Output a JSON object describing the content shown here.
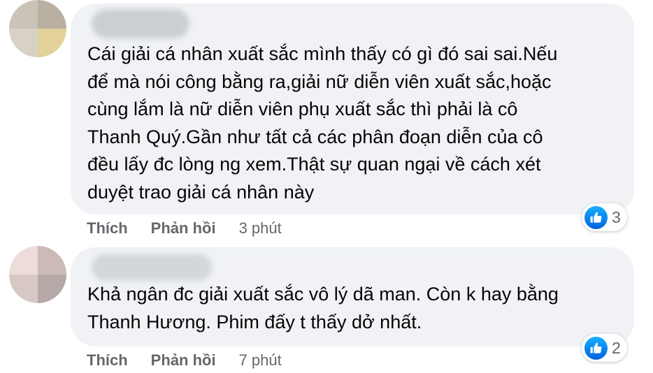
{
  "comments": [
    {
      "text": "Cái giải cá nhân xuất sắc mình thấy có gì đó sai sai.Nếu\nđể mà nói công bằng ra,giải nữ diễn viên xuất sắc,hoặc\ncùng lắm là nữ diễn viên phụ xuất sắc thì phải là cô\nThanh Quý.Gần như tất cả các phân đoạn diễn của cô\nđều lấy đc lòng ng xem.Thật sự quan ngại về cách xét\nduyệt trao giải cá nhân này",
      "like_label": "Thích",
      "reply_label": "Phản hồi",
      "time": "3 phút",
      "reaction_icon": "like-icon",
      "reaction_count": "3",
      "avatar_colors": [
        "#c9c3b8",
        "#b9b0a2",
        "#d8d2c6",
        "#e2d29a"
      ],
      "name_blur_color": "#c8cbd0"
    },
    {
      "text": "Khả ngân đc giải xuất sắc vô lý dã man. Còn k hay bằng\nThanh Hương. Phim đấy t thấy dở nhất.",
      "like_label": "Thích",
      "reply_label": "Phản hồi",
      "time": "7 phút",
      "reaction_icon": "like-icon",
      "reaction_count": "2",
      "avatar_colors": [
        "#ecdcda",
        "#cbbab7",
        "#d7c8c5",
        "#b5a9a7"
      ],
      "name_blur_color": "#d0d3d8"
    }
  ],
  "colors": {
    "bubble": "#f0f2f5",
    "text": "#050505",
    "secondary_text": "#65676b",
    "like_blue": "#1877f2"
  }
}
